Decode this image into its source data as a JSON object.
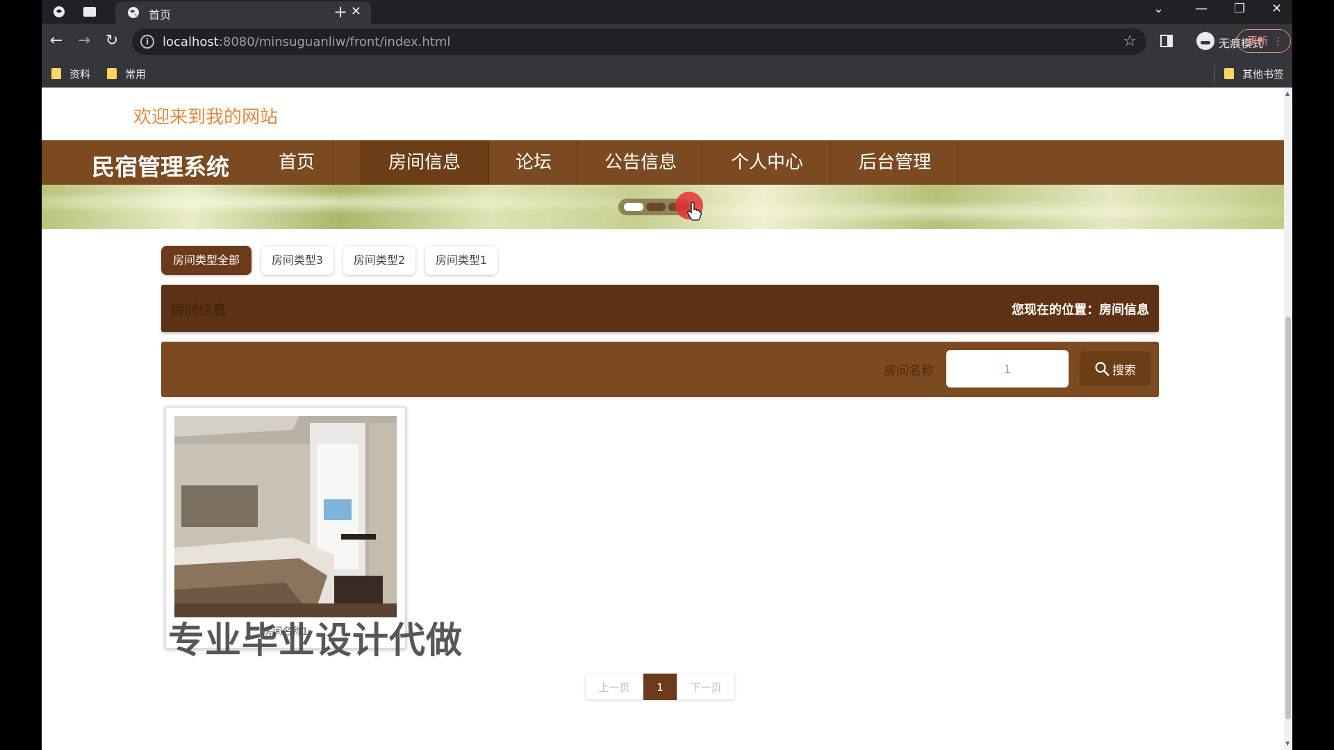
{
  "browser": {
    "tab_title": "首页",
    "url_host": "localhost",
    "url_rest": ":8080/minsuguanliw/front/index.html",
    "incognito_label": "无痕模式",
    "update_label": "更新",
    "bookmarks": [
      "资料",
      "常用"
    ],
    "other_bookmarks": "其他书签"
  },
  "page": {
    "welcome": "欢迎来到我的网站",
    "site_title": "民宿管理系统",
    "nav": [
      "首页",
      "房间信息",
      "论坛",
      "公告信息",
      "个人中心",
      "后台管理"
    ],
    "active_nav": "房间信息",
    "categories": [
      "房间类型全部",
      "房间类型3",
      "房间类型2",
      "房间类型1"
    ],
    "active_category": "房间类型全部",
    "info_title": "房间信息",
    "location": "您现在的位置：房间信息",
    "search_label": "房间名称",
    "search_value": "1",
    "search_button": "搜索",
    "card_name": "房间名称1",
    "watermark": "专业毕业设计代做",
    "pagination": {
      "prev": "上一页",
      "current": "1",
      "next": "下一页"
    }
  },
  "colors": {
    "nav_bg": "#7b4a20",
    "accent": "#6b3a1a",
    "welcome": "#e08a3c"
  }
}
